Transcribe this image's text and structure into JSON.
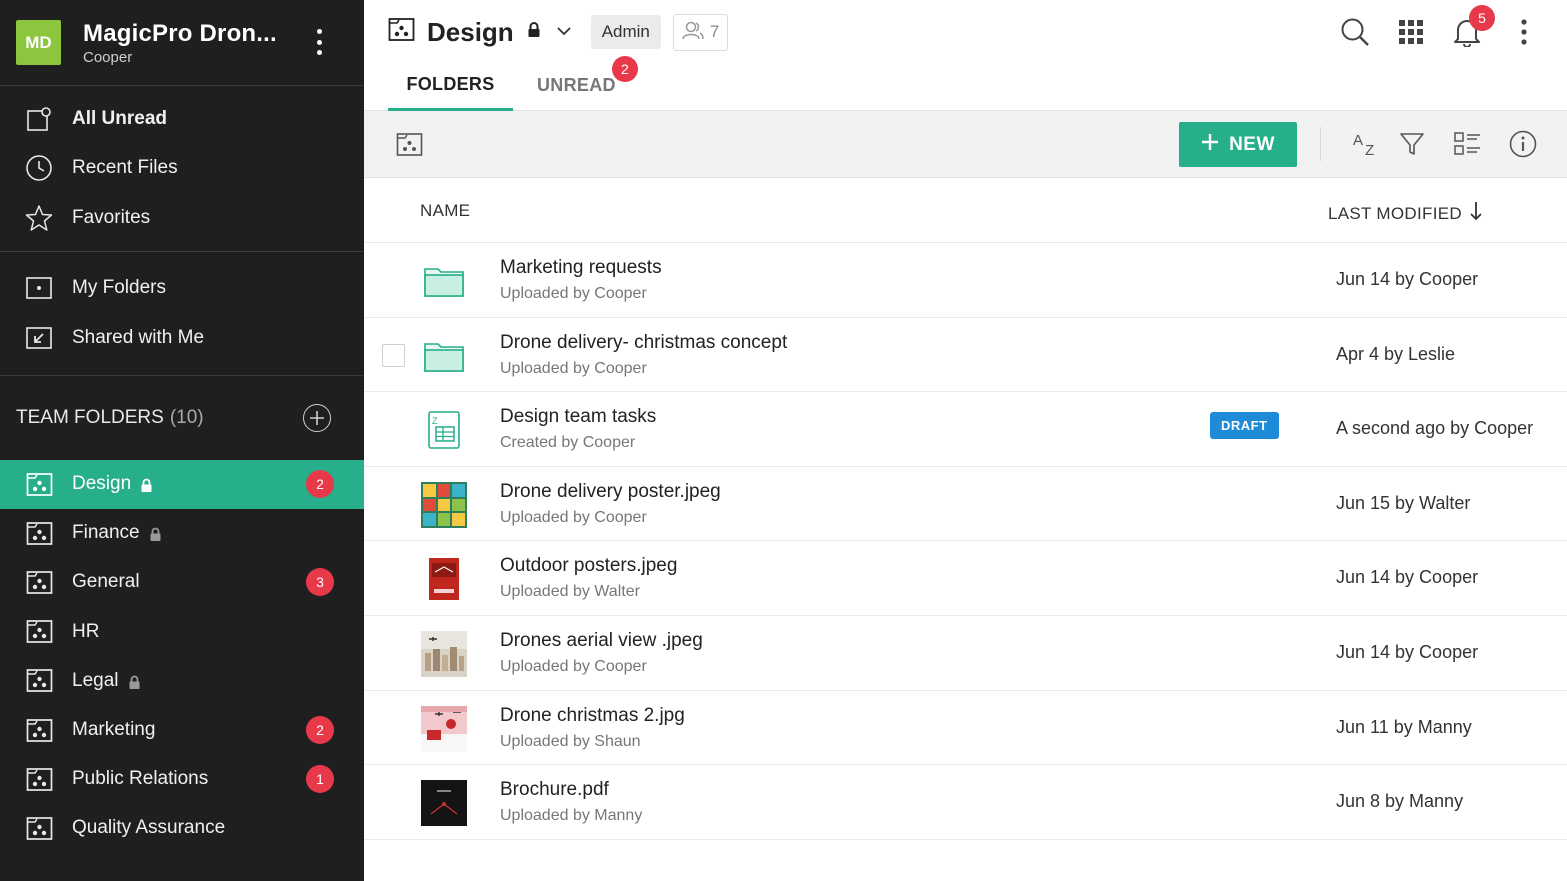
{
  "workspace": {
    "initials": "MD",
    "name": "MagicPro Dron...",
    "user": "Cooper",
    "avatar_color": "#8cc63f"
  },
  "nav_primary": [
    {
      "label": "All Unread",
      "icon": "unread-icon",
      "bold": true
    },
    {
      "label": "Recent Files",
      "icon": "clock-icon"
    },
    {
      "label": "Favorites",
      "icon": "star-icon"
    }
  ],
  "nav_secondary": [
    {
      "label": "My Folders",
      "icon": "folder-icon"
    },
    {
      "label": "Shared with Me",
      "icon": "shared-icon"
    }
  ],
  "team_folders": {
    "title": "TEAM FOLDERS",
    "count": "(10)",
    "items": [
      {
        "label": "Design",
        "locked": true,
        "badge": "2",
        "active": true
      },
      {
        "label": "Finance",
        "locked": true,
        "badge": null
      },
      {
        "label": "General",
        "locked": false,
        "badge": "3"
      },
      {
        "label": "HR",
        "locked": false,
        "badge": null
      },
      {
        "label": "Legal",
        "locked": true,
        "badge": null
      },
      {
        "label": "Marketing",
        "locked": false,
        "badge": "2"
      },
      {
        "label": "Public Relations",
        "locked": false,
        "badge": "1"
      },
      {
        "label": "Quality Assurance",
        "locked": false,
        "badge": null
      }
    ]
  },
  "header": {
    "title": "Design",
    "role": "Admin",
    "members": "7",
    "notifications": "5"
  },
  "tabs": [
    {
      "label": "FOLDERS",
      "active": true
    },
    {
      "label": "UNREAD",
      "badge": "2"
    }
  ],
  "toolbar": {
    "new_label": "NEW"
  },
  "columns": {
    "name": "NAME",
    "modified": "LAST MODIFIED"
  },
  "files": [
    {
      "title": "Marketing requests",
      "sub": "Uploaded by Cooper",
      "modified": "Jun 14 by Cooper",
      "type": "folder"
    },
    {
      "title": "Drone delivery- christmas concept",
      "sub": "Uploaded by Cooper",
      "modified": "Apr 4 by Leslie",
      "type": "folder",
      "checkbox": true
    },
    {
      "title": "Design team tasks",
      "sub": "Created by Cooper",
      "modified": "A second ago by Cooper",
      "type": "sheet",
      "tag": "DRAFT"
    },
    {
      "title": "Drone delivery poster.jpeg",
      "sub": "Uploaded by Cooper",
      "modified": "Jun 15 by Walter",
      "type": "poster-grid"
    },
    {
      "title": "Outdoor posters.jpeg",
      "sub": "Uploaded by Walter",
      "modified": "Jun 14 by Cooper",
      "type": "poster-red"
    },
    {
      "title": "Drones aerial view .jpeg",
      "sub": "Uploaded by Cooper",
      "modified": "Jun 14 by Cooper",
      "type": "photo-aerial"
    },
    {
      "title": "Drone christmas 2.jpg",
      "sub": "Uploaded by Shaun",
      "modified": "Jun 11 by Manny",
      "type": "photo-christmas"
    },
    {
      "title": "Brochure.pdf",
      "sub": "Uploaded by Manny",
      "modified": "Jun 8 by Manny",
      "type": "pdf-dark"
    }
  ],
  "colors": {
    "accent": "#27ae8a",
    "badge": "#e8394b",
    "sidebar": "#1f1f1f",
    "draft": "#1e8bd9"
  }
}
